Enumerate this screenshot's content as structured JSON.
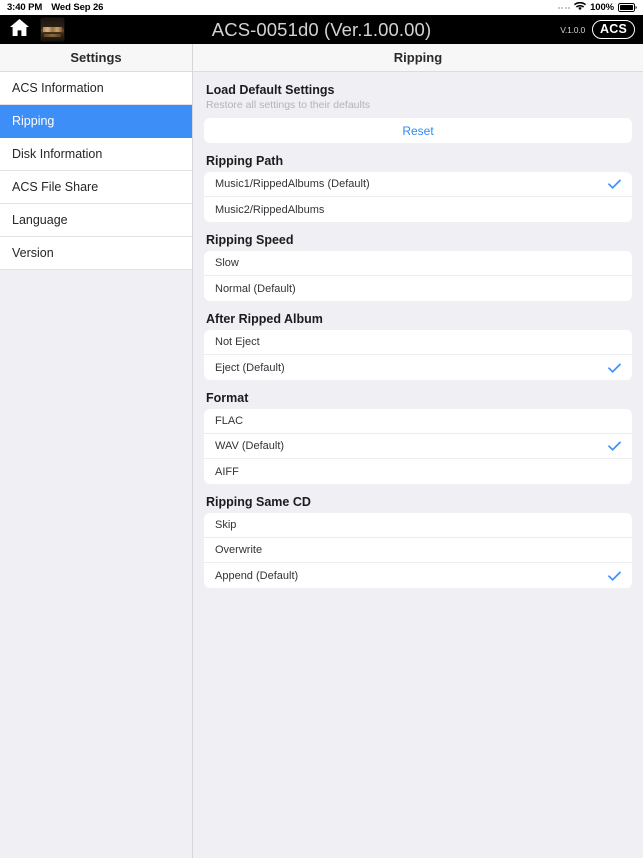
{
  "status_bar": {
    "time": "3:40 PM",
    "date": "Wed Sep 26",
    "battery_percent": "100%",
    "wifi_icon": "wifi-icon",
    "battery_icon": "battery-full-icon"
  },
  "nav_bar": {
    "home_icon": "home-icon",
    "album_thumbnail": "album-art-thumbnail",
    "title": "ACS-0051d0 (Ver.1.00.00)",
    "version": "V.1.0.0",
    "badge": "ACS",
    "background": "#000000",
    "title_color": "#d2d2d2"
  },
  "sidebar": {
    "header": "Settings",
    "selected": "Ripping",
    "accent": "#3d8ef7",
    "items": [
      {
        "label": "ACS Information",
        "selected": false
      },
      {
        "label": "Ripping",
        "selected": true
      },
      {
        "label": "Disk Information",
        "selected": false
      },
      {
        "label": "ACS File Share",
        "selected": false
      },
      {
        "label": "Language",
        "selected": false
      },
      {
        "label": "Version",
        "selected": false
      }
    ]
  },
  "main": {
    "header": "Ripping",
    "accent": "#3d8ef7",
    "load_default": {
      "title": "Load Default Settings",
      "subtitle": "Restore all settings to their defaults",
      "reset_label": "Reset"
    },
    "sections": [
      {
        "title": "Ripping Path",
        "options": [
          {
            "label": "Music1/RippedAlbums (Default)",
            "checked": true
          },
          {
            "label": "Music2/RippedAlbums",
            "checked": false
          }
        ]
      },
      {
        "title": "Ripping Speed",
        "options": [
          {
            "label": "Slow",
            "checked": false
          },
          {
            "label": "Normal (Default)",
            "checked": false
          }
        ]
      },
      {
        "title": "After Ripped Album",
        "options": [
          {
            "label": "Not Eject",
            "checked": false
          },
          {
            "label": "Eject (Default)",
            "checked": true
          }
        ]
      },
      {
        "title": "Format",
        "options": [
          {
            "label": "FLAC",
            "checked": false
          },
          {
            "label": "WAV (Default)",
            "checked": true
          },
          {
            "label": "AIFF",
            "checked": false
          }
        ]
      },
      {
        "title": "Ripping Same CD",
        "options": [
          {
            "label": "Skip",
            "checked": false
          },
          {
            "label": "Overwrite",
            "checked": false
          },
          {
            "label": "Append (Default)",
            "checked": true
          }
        ]
      }
    ]
  }
}
